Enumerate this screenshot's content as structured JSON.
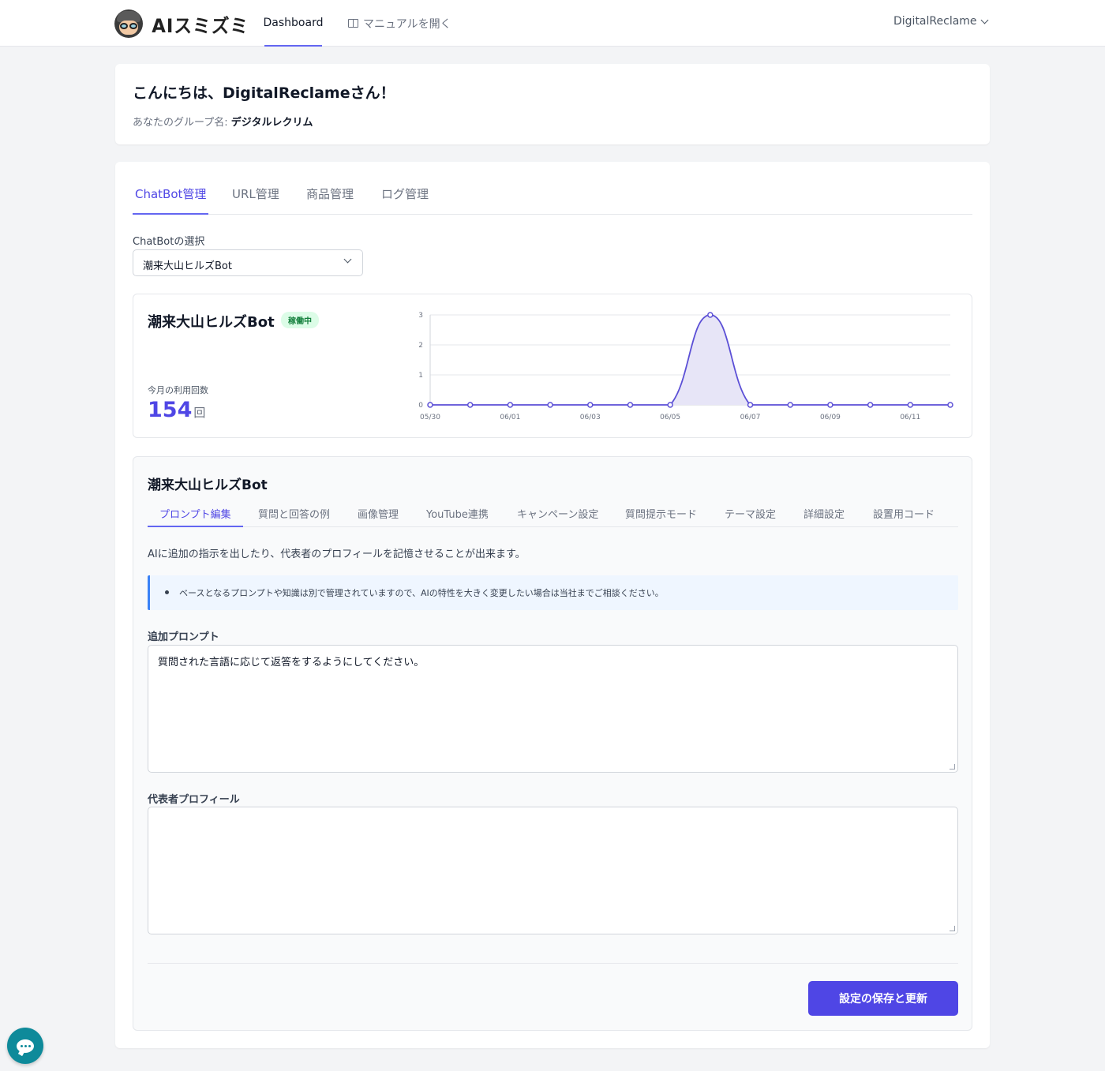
{
  "nav": {
    "logo_text": "AIスミズミ",
    "dashboard": "Dashboard",
    "manual": "マニュアルを開く",
    "user": "DigitalReclame"
  },
  "welcome": {
    "greeting": "こんにちは、DigitalReclameさん！",
    "group_label": "あなたのグループ名: ",
    "group_name": "デジタルレクリム"
  },
  "tabs": [
    "ChatBot管理",
    "URL管理",
    "商品管理",
    "ログ管理"
  ],
  "chatbot_select": {
    "label": "ChatBotの選択",
    "value": "潮来大山ヒルズBot"
  },
  "bot": {
    "name": "潮来大山ヒルズBot",
    "status": "稼働中",
    "usage_label": "今月の利用回数",
    "usage_value": "154",
    "usage_unit": "回"
  },
  "chart_data": {
    "type": "area",
    "x": [
      "05/30",
      "05/31",
      "06/01",
      "06/02",
      "06/03",
      "06/04",
      "06/05",
      "06/06",
      "06/07",
      "06/08",
      "06/09",
      "06/10",
      "06/11",
      "06/12"
    ],
    "values": [
      0,
      0,
      0,
      0,
      0,
      0,
      0,
      3,
      0,
      0,
      0,
      0,
      0,
      0
    ],
    "tick_labels": [
      "05/30",
      "06/01",
      "06/03",
      "06/05",
      "06/07",
      "06/09",
      "06/11"
    ],
    "yticks": [
      "0",
      "1",
      "2",
      "3"
    ],
    "ylim": [
      0,
      3
    ],
    "grid": true,
    "color": "#5b4fd6",
    "fill": "#e7e5f7"
  },
  "settings": {
    "title": "潮来大山ヒルズBot",
    "subtabs": [
      "プロンプト編集",
      "質問と回答の例",
      "画像管理",
      "YouTube連携",
      "キャンペーン設定",
      "質問提示モード",
      "テーマ設定",
      "詳細設定",
      "設置用コード"
    ],
    "description": "AIに追加の指示を出したり、代表者のプロフィールを記憶させることが出来ます。",
    "note": "ベースとなるプロンプトや知識は別で管理されていますので、AIの特性を大きく変更したい場合は当社までご相談ください。",
    "prompt_label": "追加プロンプト",
    "prompt_value": "質問された言語に応じて返答をするようにしてください。",
    "profile_label": "代表者プロフィール",
    "profile_value": "",
    "save_button": "設定の保存と更新"
  }
}
